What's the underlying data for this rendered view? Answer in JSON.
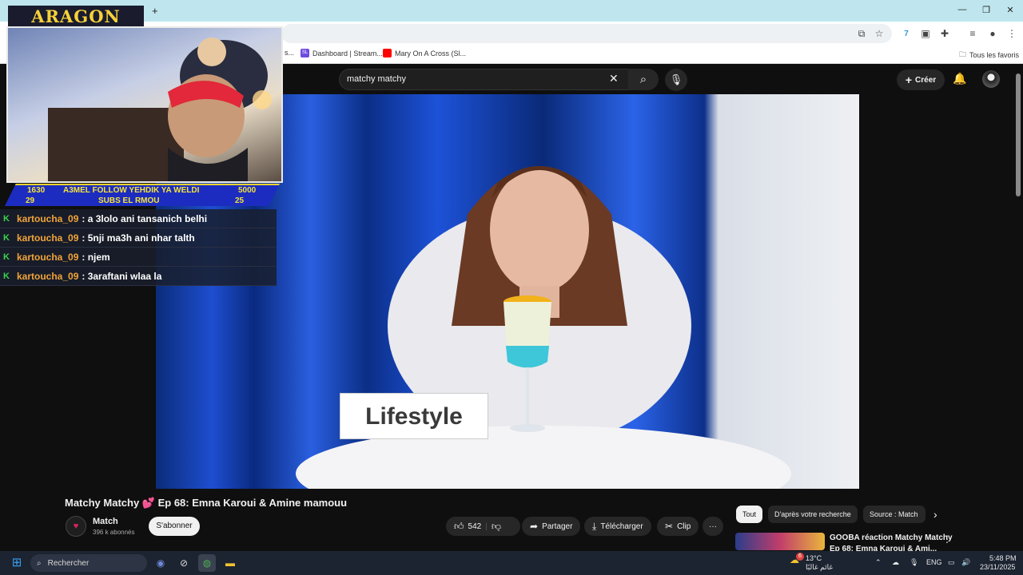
{
  "browser": {
    "new_tab_label": "+",
    "window_controls": {
      "minimize": "—",
      "restore": "❐",
      "close": "✕"
    },
    "bookmarks": [
      {
        "label": "Dashboard | Stream...",
        "icon": "SL",
        "color": "#6e4be0"
      },
      {
        "label": "Mary On A Cross (Sl...",
        "icon": "youtube-icon",
        "color": "#ff0000"
      }
    ],
    "bookmark_fragment": "s...",
    "all_bookmarks_label": "Tous les favoris"
  },
  "youtube": {
    "search": {
      "value": "matchy matchy"
    },
    "create_label": "Créer",
    "video": {
      "sign_text": "Lifestyle",
      "title": "Matchy Matchy 💕 Ep 68: Emna Karoui & Amine mamouu",
      "channel": {
        "name": "Match",
        "subscribers": "396 k abonnés"
      },
      "subscribe_label": "S'abonner",
      "likes": "542",
      "share_label": "Partager",
      "download_label": "Télécharger",
      "clip_label": "Clip",
      "more_label": "···"
    },
    "chips": [
      "Tout",
      "D'après votre recherche",
      "Source : Match"
    ],
    "recommendation": {
      "title_line1": "GOOBA réaction Matchy Matchy",
      "title_line2": "Ep 68: Emna Karoui & Ami..."
    }
  },
  "overlay": {
    "logo": "ARAGON",
    "banner": {
      "left_top": "1630",
      "left_bottom": "29",
      "center_top": "A3MEL FOLLOW YEHDIK YA WELDI",
      "center_bottom": "SUBS EL RMOU",
      "right_top": "5000",
      "right_bottom": "25"
    },
    "chat": [
      {
        "user": "kartoucha_09",
        "message": ": a 3lolo ani tansanich belhi"
      },
      {
        "user": "kartoucha_09",
        "message": ": 5nji ma3h ani nhar talth"
      },
      {
        "user": "kartoucha_09",
        "message": ": njem"
      },
      {
        "user": "kartoucha_09",
        "message": ": 3araftani wlaa la"
      }
    ]
  },
  "taskbar": {
    "search_placeholder": "Rechercher",
    "weather": {
      "temp": "13°C",
      "label": "غائم غالبًا",
      "badge": "6"
    },
    "language": "ENG",
    "time": "5:48 PM",
    "date": "23/11/2025"
  }
}
